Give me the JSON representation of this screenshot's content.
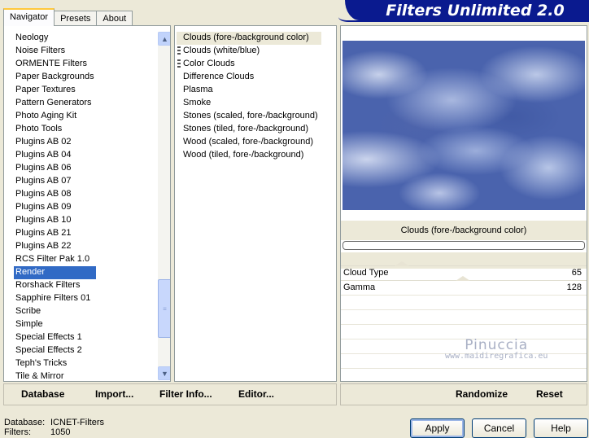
{
  "banner": {
    "title": "Filters Unlimited 2.0"
  },
  "tabs": [
    {
      "label": "Navigator",
      "active": true
    },
    {
      "label": "Presets",
      "active": false
    },
    {
      "label": "About",
      "active": false
    }
  ],
  "categories": [
    "Neology",
    "Noise Filters",
    "ORMENTE Filters",
    "Paper Backgrounds",
    "Paper Textures",
    "Pattern Generators",
    "Photo Aging Kit",
    "Photo Tools",
    "Plugins AB 02",
    "Plugins AB 04",
    "Plugins AB 06",
    "Plugins AB 07",
    "Plugins AB 08",
    "Plugins AB 09",
    "Plugins AB 10",
    "Plugins AB 21",
    "Plugins AB 22",
    "RCS Filter Pak 1.0",
    "Render",
    "Rorshack Filters",
    "Sapphire Filters 01",
    "Scribe",
    "Simple",
    "Special Effects 1",
    "Special Effects 2",
    "Teph's Tricks",
    "Tile & Mirror"
  ],
  "selected_category": "Render",
  "filters": [
    {
      "label": "Clouds (fore-/background color)",
      "marked": false
    },
    {
      "label": "Clouds (white/blue)",
      "marked": true
    },
    {
      "label": "Color Clouds",
      "marked": true
    },
    {
      "label": "Difference Clouds",
      "marked": false
    },
    {
      "label": "Plasma",
      "marked": false
    },
    {
      "label": "Smoke",
      "marked": false
    },
    {
      "label": "Stones (scaled, fore-/background)",
      "marked": false
    },
    {
      "label": "Stones (tiled, fore-/background)",
      "marked": false
    },
    {
      "label": "Wood (scaled, fore-/background)",
      "marked": false
    },
    {
      "label": "Wood (tiled, fore-/background)",
      "marked": false
    }
  ],
  "selected_filter": "Clouds (fore-/background color)",
  "preview": {
    "filter_name": "Clouds (fore-/background color)",
    "progress": 0
  },
  "params": [
    {
      "name": "Cloud Type",
      "value": "65"
    },
    {
      "name": "Gamma",
      "value": "128"
    }
  ],
  "watermark": {
    "line1": "Pinuccia",
    "line2": "www.maidiregrafica.eu"
  },
  "bottom_left": {
    "database": "Database",
    "import": "Import...",
    "filter_info": "Filter Info...",
    "editor": "Editor..."
  },
  "bottom_right": {
    "randomize": "Randomize",
    "reset": "Reset"
  },
  "status": {
    "database_label": "Database:",
    "database_value": "ICNET-Filters",
    "filters_label": "Filters:",
    "filters_value": "1050"
  },
  "buttons": {
    "apply": "Apply",
    "cancel": "Cancel",
    "help": "Help"
  }
}
